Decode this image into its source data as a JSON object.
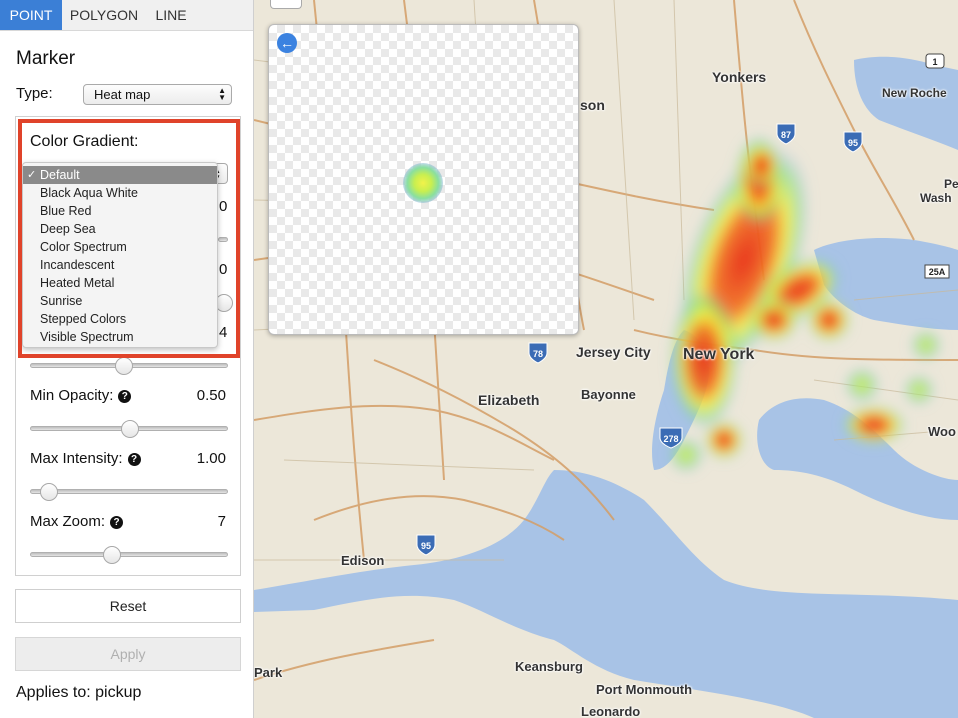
{
  "tabs": [
    "POINT",
    "POLYGON",
    "LINE"
  ],
  "panel": {
    "title": "Marker",
    "type_label": "Type:",
    "type_value": "Heat map",
    "color_gradient_label": "Color Gradient:",
    "gradient_options": [
      "Default",
      "Black Aqua White",
      "Blue Red",
      "Deep Sea",
      "Color Spectrum",
      "Incandescent",
      "Heated Metal",
      "Sunrise",
      "Stepped Colors",
      "Visible Spectrum"
    ],
    "gradient_selected": "Default",
    "hidden_values": [
      "0",
      "0",
      "4"
    ],
    "sliders": [
      {
        "label": "Min Opacity:",
        "value": "0.50",
        "fraction": 0.5
      },
      {
        "label": "Max Intensity:",
        "value": "1.00",
        "fraction": 0.05
      },
      {
        "label": "Max Zoom:",
        "value": "7",
        "fraction": 0.4
      }
    ],
    "reset_label": "Reset",
    "apply_label": "Apply",
    "applies_to": "Applies to: pickup"
  },
  "map": {
    "labels": [
      "Yonkers",
      "son",
      "New Roche",
      "Pe",
      "Wash",
      "Jersey City",
      "New York",
      "Elizabeth",
      "Bayonne",
      "Edison",
      "Woo",
      "Keansburg",
      "Port Monmouth",
      "Leonardo",
      "Park"
    ],
    "shields": [
      "87",
      "95",
      "78",
      "278",
      "95",
      "25A",
      "1"
    ]
  },
  "colors": {
    "accent": "#3b7fd6",
    "highlight": "#e0432a",
    "heat_red": "#e8321e",
    "heat_yellow": "#f5f33a",
    "heat_green": "#7fe07a",
    "water": "#a8c3e6",
    "land": "#ece7d9"
  }
}
